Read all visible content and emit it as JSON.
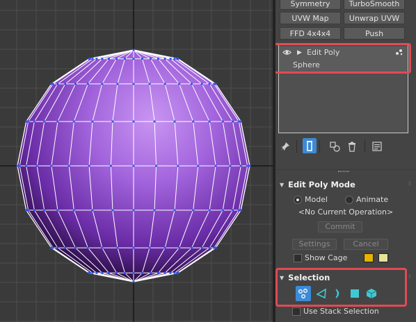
{
  "modifier_buttons": [
    {
      "label": "Symmetry"
    },
    {
      "label": "TurboSmooth"
    },
    {
      "label": "UVW Map"
    },
    {
      "label": "Unwrap UVW"
    },
    {
      "label": "FFD 4x4x4"
    },
    {
      "label": "Push"
    }
  ],
  "modifier_stack": {
    "items": [
      {
        "label": "Edit Poly"
      },
      {
        "label": "Sphere"
      }
    ]
  },
  "stack_toolbar": {
    "icons": [
      "pin-icon",
      "show-end-result-icon",
      "make-unique-icon",
      "remove-modifier-icon",
      "configure-modifier-sets-icon"
    ]
  },
  "edit_poly_mode": {
    "title": "Edit Poly Mode",
    "model_label": "Model",
    "animate_label": "Animate",
    "selected_mode": "Model",
    "current_operation": "<No Current Operation>",
    "commit_label": "Commit",
    "settings_label": "Settings",
    "cancel_label": "Cancel",
    "show_cage_label": "Show Cage",
    "cage_colors": [
      "#e8b300",
      "#e6e39a"
    ]
  },
  "selection": {
    "title": "Selection",
    "subobject_levels": [
      "vertex-icon",
      "edge-icon",
      "border-icon",
      "polygon-icon",
      "element-icon"
    ],
    "use_stack_selection_label": "Use Stack Selection"
  },
  "colors": {
    "highlight": "#e24a55",
    "sphere": "#9a5ad8",
    "accent_blue": "#3d8ad6",
    "accent_cyan": "#3fc8d4"
  }
}
